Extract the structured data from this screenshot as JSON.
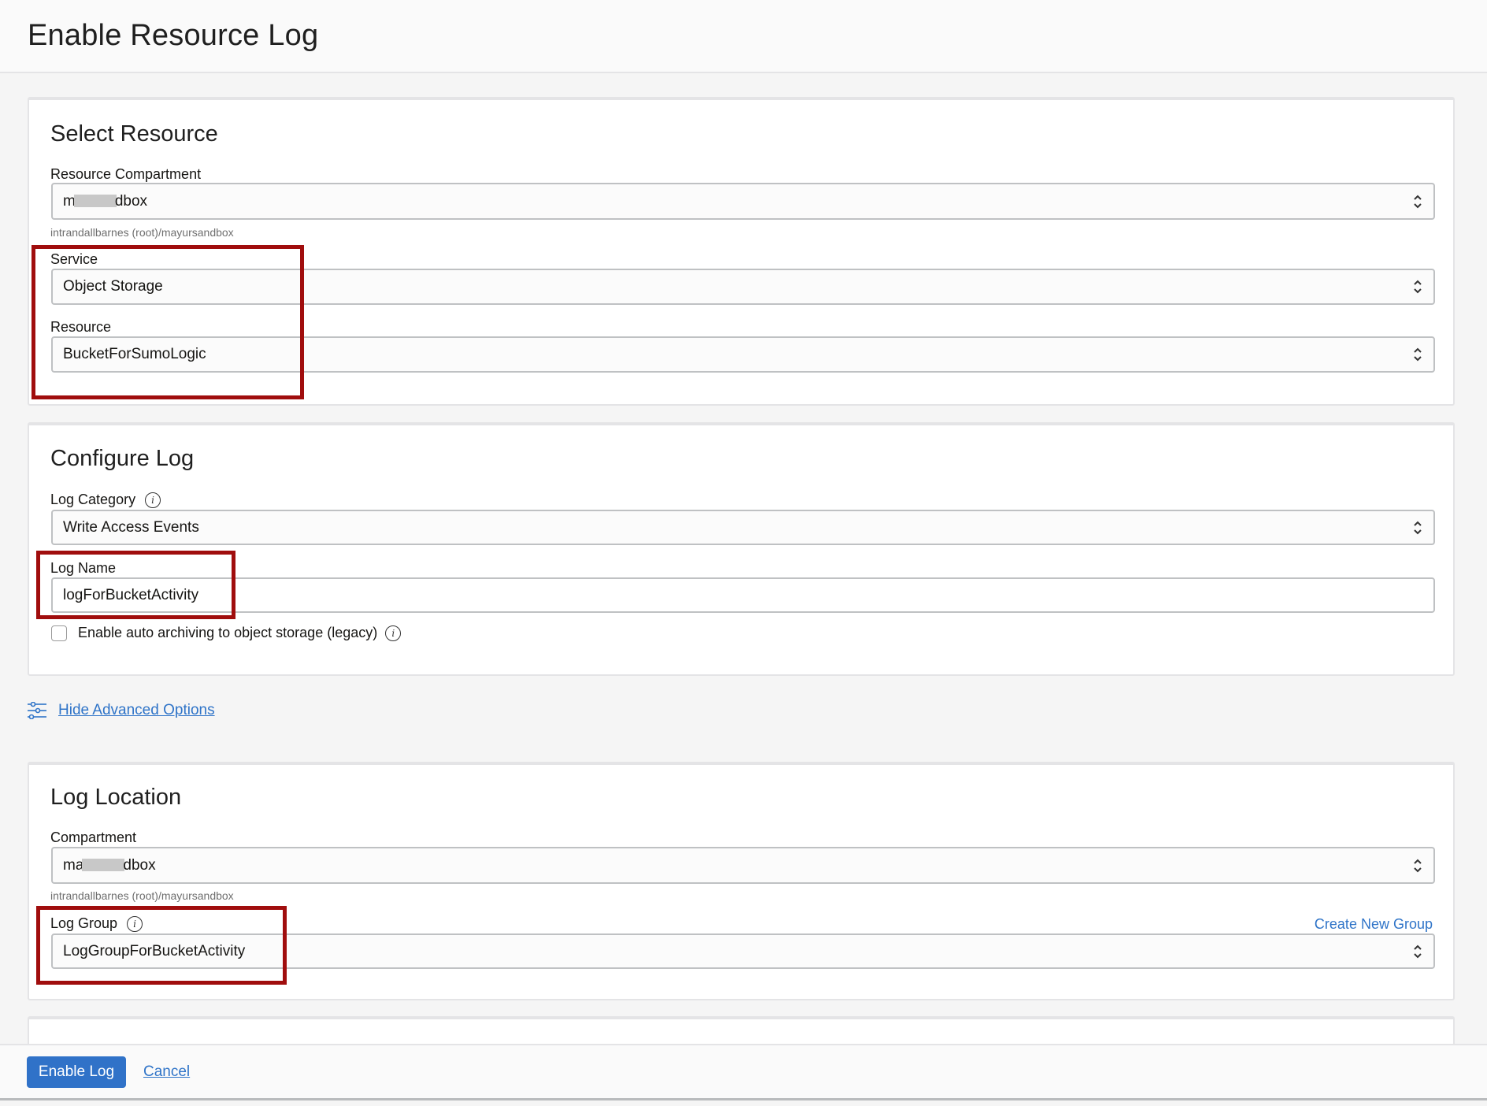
{
  "header": {
    "title": "Enable Resource Log"
  },
  "select_resource": {
    "title": "Select Resource",
    "resource_compartment": {
      "label": "Resource Compartment",
      "value_prefix": "m",
      "value_suffix": "dbox",
      "helper": "intrandallbarnes (root)/mayursandbox"
    },
    "service": {
      "label": "Service",
      "value": "Object Storage"
    },
    "resource": {
      "label": "Resource",
      "value": "BucketForSumoLogic"
    }
  },
  "configure_log": {
    "title": "Configure Log",
    "log_category": {
      "label": "Log Category",
      "value": "Write Access Events"
    },
    "log_name": {
      "label": "Log Name",
      "value": "logForBucketActivity"
    },
    "auto_archive": {
      "label": "Enable auto archiving to object storage (legacy)",
      "checked": false
    }
  },
  "advanced": {
    "toggle_label": "Hide Advanced Options"
  },
  "log_location": {
    "title": "Log Location",
    "compartment": {
      "label": "Compartment",
      "value_prefix": "ma",
      "value_suffix": "dbox",
      "helper": "intrandallbarnes (root)/mayursandbox"
    },
    "log_group": {
      "label": "Log Group",
      "value": "LogGroupForBucketActivity",
      "create_link": "Create New Group"
    }
  },
  "footer": {
    "primary_label": "Enable Log",
    "cancel_label": "Cancel"
  },
  "colors": {
    "accent": "#3072c8",
    "link": "#2f74c8",
    "highlight": "#a00d0d"
  }
}
